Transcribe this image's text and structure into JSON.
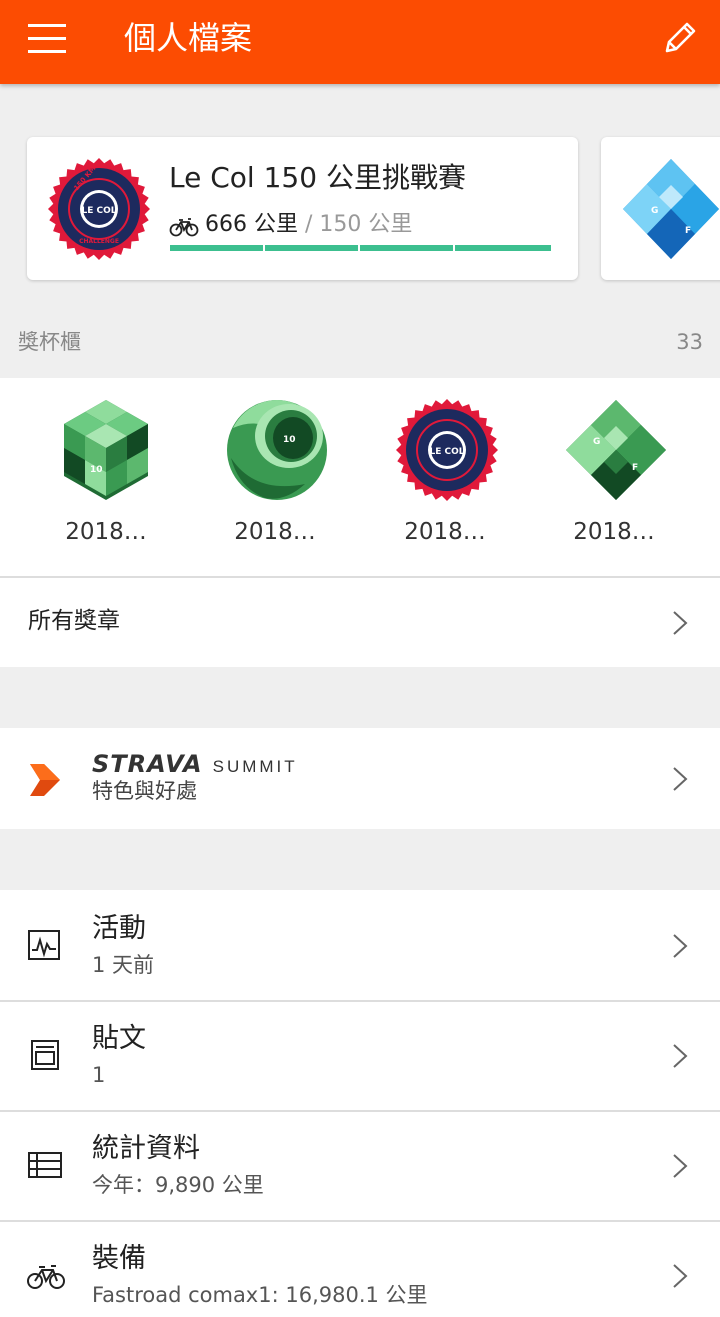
{
  "app_bar": {
    "title": "個人檔案",
    "menu_icon": "menu-icon",
    "edit_icon": "pencil-icon",
    "background": "#fc4c02"
  },
  "challenge": {
    "name": "Le Col 150 公里挑戰賽",
    "progress_value": "666 公里",
    "progress_goal": " / 150 公里",
    "progress_fraction": 1.0,
    "progress_color": "#3cbf8f",
    "badge_icon": "le-col-challenge-badge",
    "badge_text_top": "150 KM",
    "badge_text_center": "LE COL",
    "badge_text_bottom": "CHALLENGE"
  },
  "trophy_case": {
    "label": "獎杯櫃",
    "count": "33",
    "trophies": [
      {
        "label": "2018…",
        "icon": "cube-10-badge",
        "text": "10"
      },
      {
        "label": "2018…",
        "icon": "sphere-10-badge",
        "text": "10"
      },
      {
        "label": "2018…",
        "icon": "le-col-challenge-badge",
        "text": "LE COL"
      },
      {
        "label": "2018…",
        "icon": "gran-fondo-diamond-badge",
        "text_g": "G",
        "text_f": "F"
      }
    ]
  },
  "all_badges": {
    "label": "所有獎章"
  },
  "summit": {
    "brand": "STRAVA",
    "word": "SUMMIT",
    "subtitle": "特色與好處",
    "icon": "summit-chevron-icon"
  },
  "menu": [
    {
      "title": "活動",
      "subtitle": "1 天前",
      "icon": "activity-chart-icon"
    },
    {
      "title": "貼文",
      "subtitle": "1",
      "icon": "post-icon"
    },
    {
      "title": "統計資料",
      "subtitle": "今年：9,890 公里",
      "icon": "stats-table-icon"
    },
    {
      "title": "裝備",
      "subtitle": "Fastroad comax1: 16,980.1 公里",
      "icon": "bike-icon"
    }
  ]
}
